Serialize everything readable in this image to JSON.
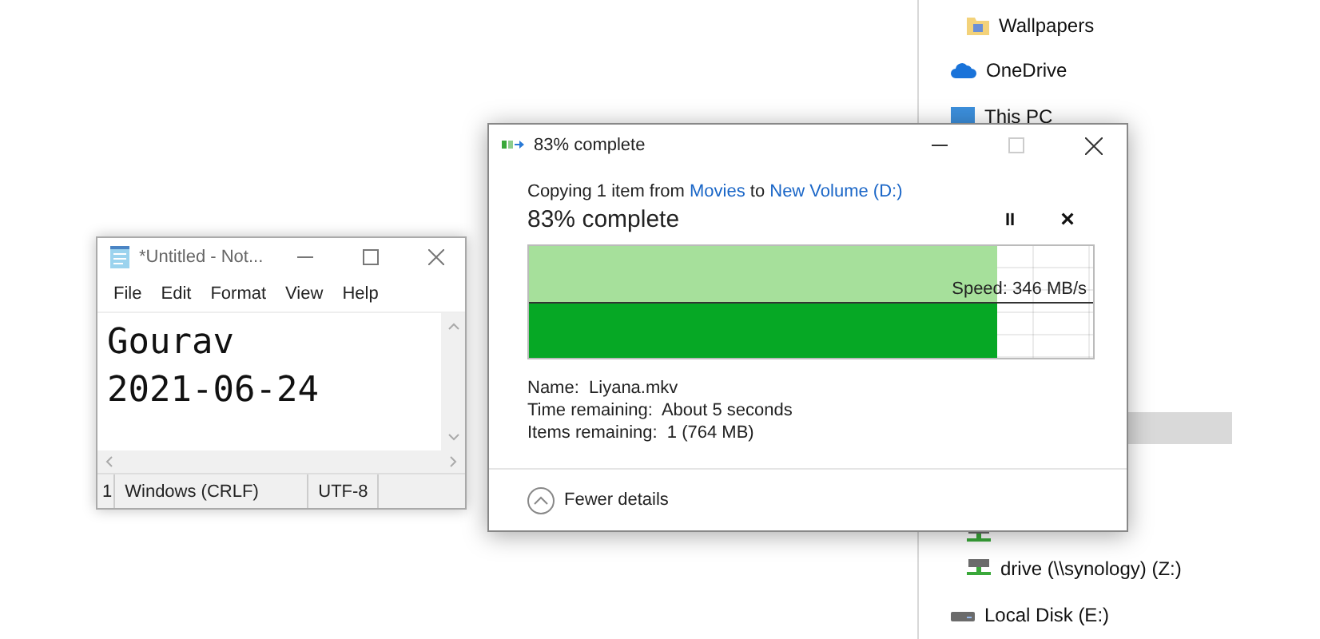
{
  "explorer": {
    "nav_items": [
      {
        "kind": "folder",
        "label": "Wallpapers"
      },
      {
        "kind": "cloud",
        "label": "OneDrive"
      },
      {
        "kind": "pc",
        "label": "This PC"
      },
      {
        "kind": "highlight",
        "selected": true
      },
      {
        "kind": "netdrive"
      },
      {
        "kind": "netdrive",
        "label": "drive (\\\\synology) (Z:)"
      },
      {
        "kind": "disk",
        "label": "Local Disk (E:)"
      }
    ]
  },
  "notepad": {
    "title": "*Untitled - Not...",
    "menu": [
      "File",
      "Edit",
      "Format",
      "View",
      "Help"
    ],
    "lines": [
      "Gourav",
      "2021-06-24"
    ],
    "status": [
      "1",
      "Windows (CRLF)",
      "UTF-8"
    ]
  },
  "copy_dialog": {
    "title": "83% complete",
    "summary": {
      "prefix": "Copying 1 item from",
      "source": "Movies",
      "middle": "to",
      "destination": "New Volume (D:)"
    },
    "heading": "83% complete",
    "pause": "II",
    "cancel": "×",
    "progress": {
      "level": 0.83,
      "speed": "Speed: 346 MB/s"
    },
    "details": [
      {
        "label": "Name:",
        "value": "Liyana.mkv"
      },
      {
        "label": "Time remaining:",
        "value": "About 5 seconds"
      },
      {
        "label": "Items remaining:",
        "value": "1 (764 MB)"
      }
    ],
    "toggle": "Fewer details"
  }
}
